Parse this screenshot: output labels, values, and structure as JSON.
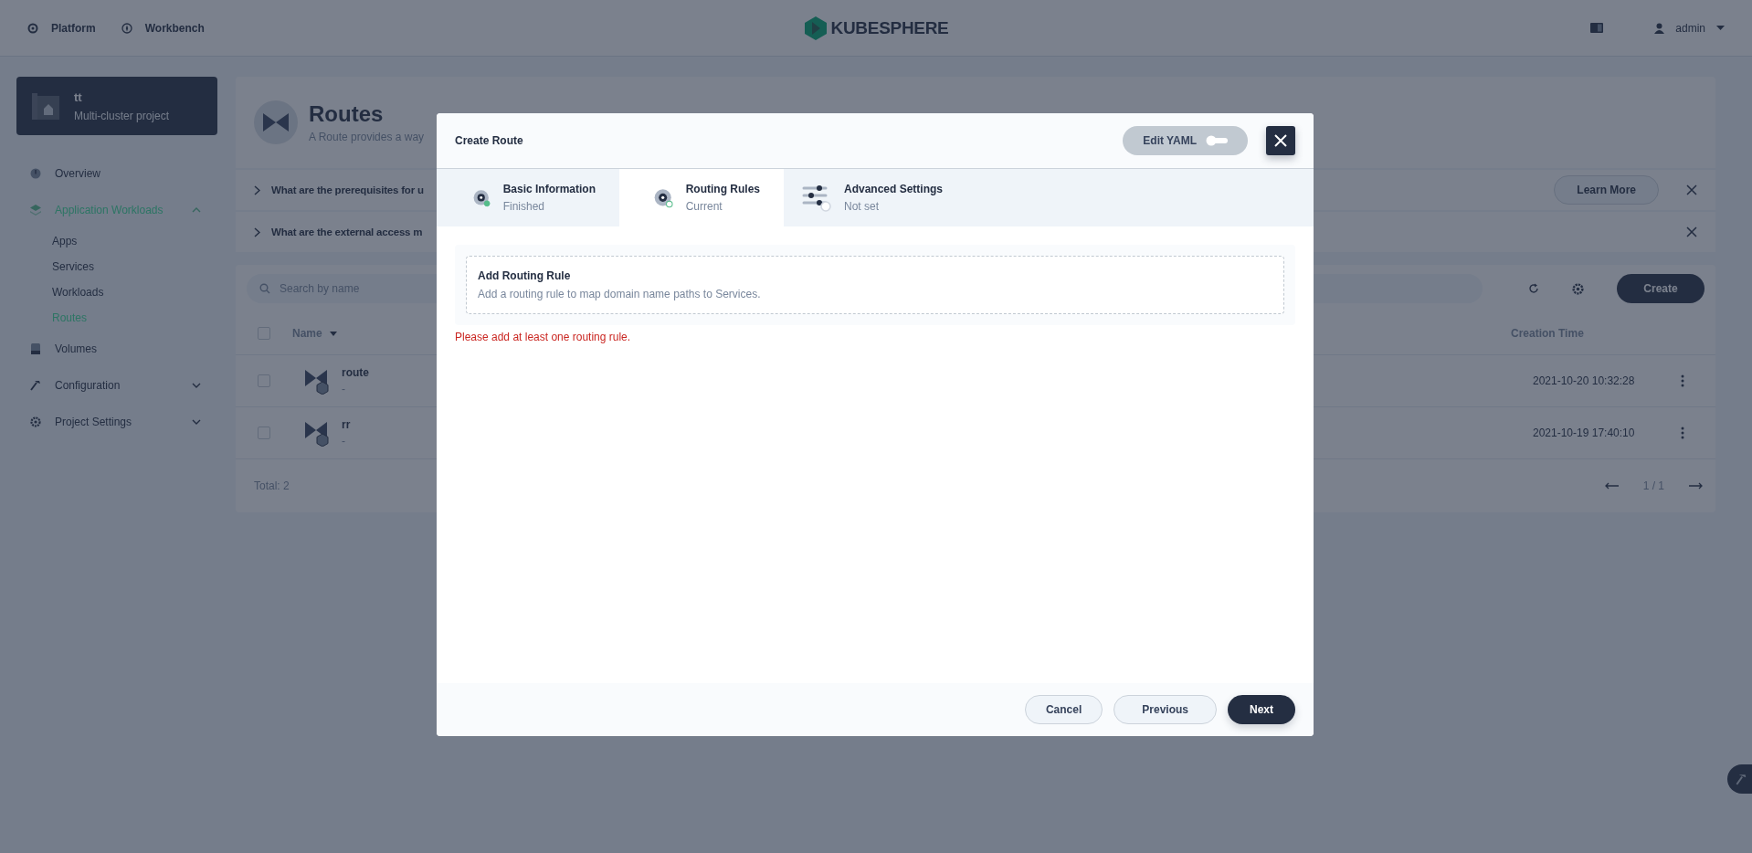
{
  "top_nav": {
    "items": [
      {
        "label": "Platform"
      },
      {
        "label": "Workbench"
      }
    ],
    "logo": "KUBESPHERE",
    "user": "admin"
  },
  "sidebar": {
    "project": {
      "name": "tt",
      "subtitle": "Multi-cluster project"
    },
    "items": [
      {
        "kind": "link",
        "label": "Overview",
        "selected": false
      },
      {
        "kind": "group",
        "label": "Application Workloads",
        "selected": true,
        "expanded": true,
        "children": [
          {
            "label": "Apps",
            "selected": false
          },
          {
            "label": "Services",
            "selected": false
          },
          {
            "label": "Workloads",
            "selected": false
          },
          {
            "label": "Routes",
            "selected": true
          }
        ]
      },
      {
        "kind": "link",
        "label": "Volumes",
        "selected": false
      },
      {
        "kind": "group",
        "label": "Configuration",
        "selected": false,
        "expanded": false
      },
      {
        "kind": "group",
        "label": "Project Settings",
        "selected": false,
        "expanded": false
      }
    ]
  },
  "page": {
    "title": "Routes",
    "description": "A Route provides a way",
    "banners": [
      {
        "text": "What are the prerequisites for u",
        "action": "Learn More"
      },
      {
        "text": "What are the external access m"
      }
    ],
    "search": {
      "placeholder": "Search by name"
    },
    "create": "Create",
    "table": {
      "header_checked": false,
      "columns": [
        "Name",
        "Creation Time"
      ],
      "rows": [
        {
          "name": "route",
          "subtitle": "-",
          "time": "2021-10-20 10:32:28",
          "checked": false
        },
        {
          "name": "rr",
          "subtitle": "-",
          "time": "2021-10-19 17:40:10",
          "checked": false
        }
      ]
    },
    "total": "Total: 2",
    "pagination": "1 / 1"
  },
  "modal": {
    "title": "Create Route",
    "edit_yaml": {
      "label": "Edit YAML",
      "on": false
    },
    "steps": [
      {
        "title": "Basic Information",
        "status": "Finished",
        "finished": true,
        "selected": false
      },
      {
        "title": "Routing Rules",
        "status": "Current",
        "finished": false,
        "selected": true
      },
      {
        "title": "Advanced Settings",
        "status": "Not set",
        "finished": false,
        "selected": false
      }
    ],
    "rule_card": {
      "title": "Add Routing Rule",
      "description": "Add a routing rule to map domain name paths to Services."
    },
    "error": "Please add at least one routing rule.",
    "buttons": [
      {
        "label": "Cancel",
        "kind": "secondary"
      },
      {
        "label": "Previous",
        "kind": "secondary"
      },
      {
        "label": "Next",
        "kind": "primary"
      }
    ]
  }
}
